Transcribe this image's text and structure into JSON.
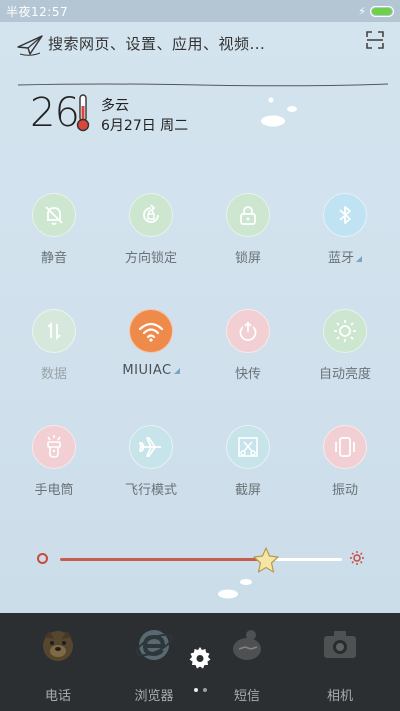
{
  "status_bar": {
    "time": "半夜12:57",
    "charging_symbol": "⚡",
    "battery_level": 1.0
  },
  "search": {
    "placeholder": "搜索网页、设置、应用、视频...",
    "icon": "paper-plane-icon",
    "scan_icon": "scan-icon"
  },
  "weather": {
    "temperature": "26",
    "condition": "多云",
    "date": "6月27日 周二",
    "icon": "thermometer-icon"
  },
  "toggles": [
    {
      "label": "静音",
      "icon": "bell-muted-icon",
      "state": "off",
      "color": "#cde6cf"
    },
    {
      "label": "方向锁定",
      "icon": "rotation-lock-icon",
      "state": "off",
      "color": "#cde6cf"
    },
    {
      "label": "锁屏",
      "icon": "padlock-icon",
      "state": "off",
      "color": "#cde6cf"
    },
    {
      "label": "蓝牙",
      "icon": "bluetooth-icon",
      "state": "off",
      "color": "#bfe3f3",
      "has_more": true
    },
    {
      "label": "数据",
      "icon": "data-arrows-icon",
      "state": "disabled",
      "color": "#d6e7dc"
    },
    {
      "label": "MIUIAC",
      "icon": "wifi-icon",
      "state": "on",
      "color": "#ee8a4a",
      "has_more": true
    },
    {
      "label": "快传",
      "icon": "power-transfer-icon",
      "state": "off",
      "color": "#f2cfd3"
    },
    {
      "label": "自动亮度",
      "icon": "sun-icon",
      "state": "off",
      "color": "#cde6cf"
    },
    {
      "label": "手电筒",
      "icon": "flashlight-icon",
      "state": "off",
      "color": "#f2cfd3"
    },
    {
      "label": "飞行模式",
      "icon": "airplane-icon",
      "state": "off",
      "color": "#c6e4ea"
    },
    {
      "label": "截屏",
      "icon": "screenshot-scissors-icon",
      "state": "off",
      "color": "#c6e4ea"
    },
    {
      "label": "振动",
      "icon": "vibrate-icon",
      "state": "off",
      "color": "#f2cfd3"
    }
  ],
  "brightness": {
    "level": 0.73,
    "min_icon": "brightness-low-icon",
    "max_icon": "brightness-high-icon",
    "thumb_icon": "star-icon"
  },
  "dock": [
    {
      "label": "电话",
      "icon": "phone-dog-icon"
    },
    {
      "label": "浏览器",
      "icon": "browser-icon"
    },
    {
      "label": "短信",
      "icon": "messages-bird-icon"
    },
    {
      "label": "相机",
      "icon": "camera-icon"
    }
  ],
  "settings_icon": "gear-icon",
  "page_indicator": {
    "count": 2,
    "active": 1
  },
  "colors": {
    "status_bar": "#b4c6d3",
    "background": "#cfe0ec",
    "accent_orange": "#ee8a4a",
    "slider_fill": "#c55e4b",
    "dock": "#2c2f31"
  }
}
